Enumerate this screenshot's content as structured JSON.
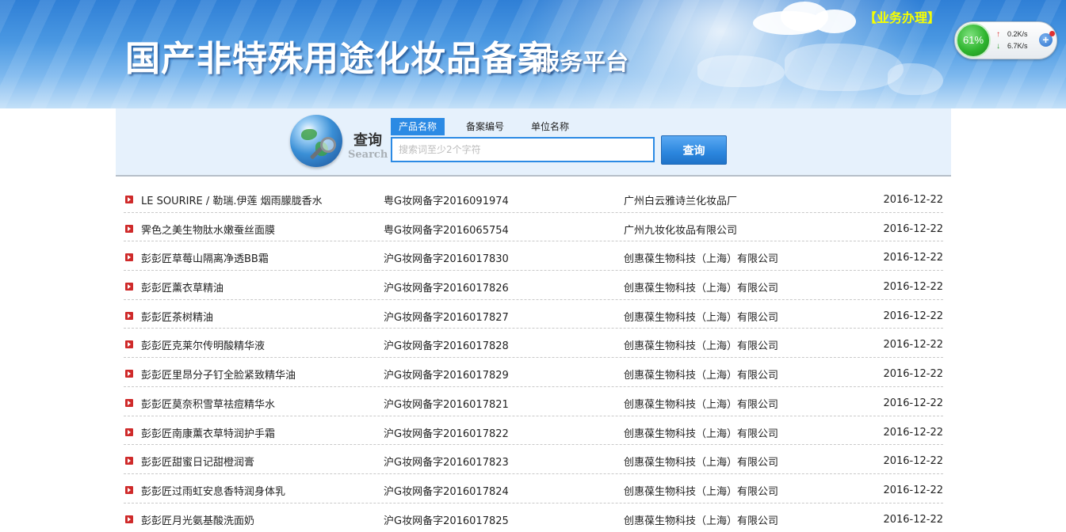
{
  "header": {
    "title": "国产非特殊用途化妆品备案",
    "subtitle": "服务平台",
    "business_link": "【业务办理】"
  },
  "speed_widget": {
    "percent": "61%",
    "upload": "0.2K/s",
    "download": "6.7K/s",
    "up_arrow": "↑",
    "down_arrow": "↓",
    "plus": "+"
  },
  "search": {
    "label_cn": "查询",
    "label_en": "Search",
    "tabs": [
      {
        "label": "产品名称",
        "active": true
      },
      {
        "label": "备案编号",
        "active": false
      },
      {
        "label": "单位名称",
        "active": false
      }
    ],
    "placeholder": "搜索词至少2个字符",
    "value": "",
    "button": "查询"
  },
  "results": [
    {
      "name": "LE SOURIRE / 勒瑞.伊莲 烟雨朦胧香水",
      "reg": "粤G妆网备字2016091974",
      "company": "广州白云雅诗兰化妆品厂",
      "date": "2016-12-22"
    },
    {
      "name": "霁色之美生物肽水嫩蚕丝面膜",
      "reg": "粤G妆网备字2016065754",
      "company": "广州九妆化妆品有限公司",
      "date": "2016-12-22"
    },
    {
      "name": "彭彭匠草莓山隔离净透BB霜",
      "reg": "沪G妆网备字2016017830",
      "company": "创惠葆生物科技（上海）有限公司",
      "date": "2016-12-22"
    },
    {
      "name": "彭彭匠薰衣草精油",
      "reg": "沪G妆网备字2016017826",
      "company": "创惠葆生物科技（上海）有限公司",
      "date": "2016-12-22"
    },
    {
      "name": "彭彭匠茶树精油",
      "reg": "沪G妆网备字2016017827",
      "company": "创惠葆生物科技（上海）有限公司",
      "date": "2016-12-22"
    },
    {
      "name": "彭彭匠克莱尔传明酸精华液",
      "reg": "沪G妆网备字2016017828",
      "company": "创惠葆生物科技（上海）有限公司",
      "date": "2016-12-22"
    },
    {
      "name": "彭彭匠里昂分子钉全脸紧致精华油",
      "reg": "沪G妆网备字2016017829",
      "company": "创惠葆生物科技（上海）有限公司",
      "date": "2016-12-22"
    },
    {
      "name": "彭彭匠莫奈积雪草祛痘精华水",
      "reg": "沪G妆网备字2016017821",
      "company": "创惠葆生物科技（上海）有限公司",
      "date": "2016-12-22"
    },
    {
      "name": "彭彭匠南康薰衣草特润护手霜",
      "reg": "沪G妆网备字2016017822",
      "company": "创惠葆生物科技（上海）有限公司",
      "date": "2016-12-22"
    },
    {
      "name": "彭彭匠甜蜜日记甜橙润膏",
      "reg": "沪G妆网备字2016017823",
      "company": "创惠葆生物科技（上海）有限公司",
      "date": "2016-12-22"
    },
    {
      "name": "彭彭匠过雨虹安息香特润身体乳",
      "reg": "沪G妆网备字2016017824",
      "company": "创惠葆生物科技（上海）有限公司",
      "date": "2016-12-22"
    },
    {
      "name": "彭彭匠月光氨基酸洗面奶",
      "reg": "沪G妆网备字2016017825",
      "company": "创惠葆生物科技（上海）有限公司",
      "date": "2016-12-22"
    }
  ],
  "colors": {
    "accent": "#2b8ae4",
    "business_link": "#f6ff00",
    "bullet": "#cf2a2a"
  }
}
